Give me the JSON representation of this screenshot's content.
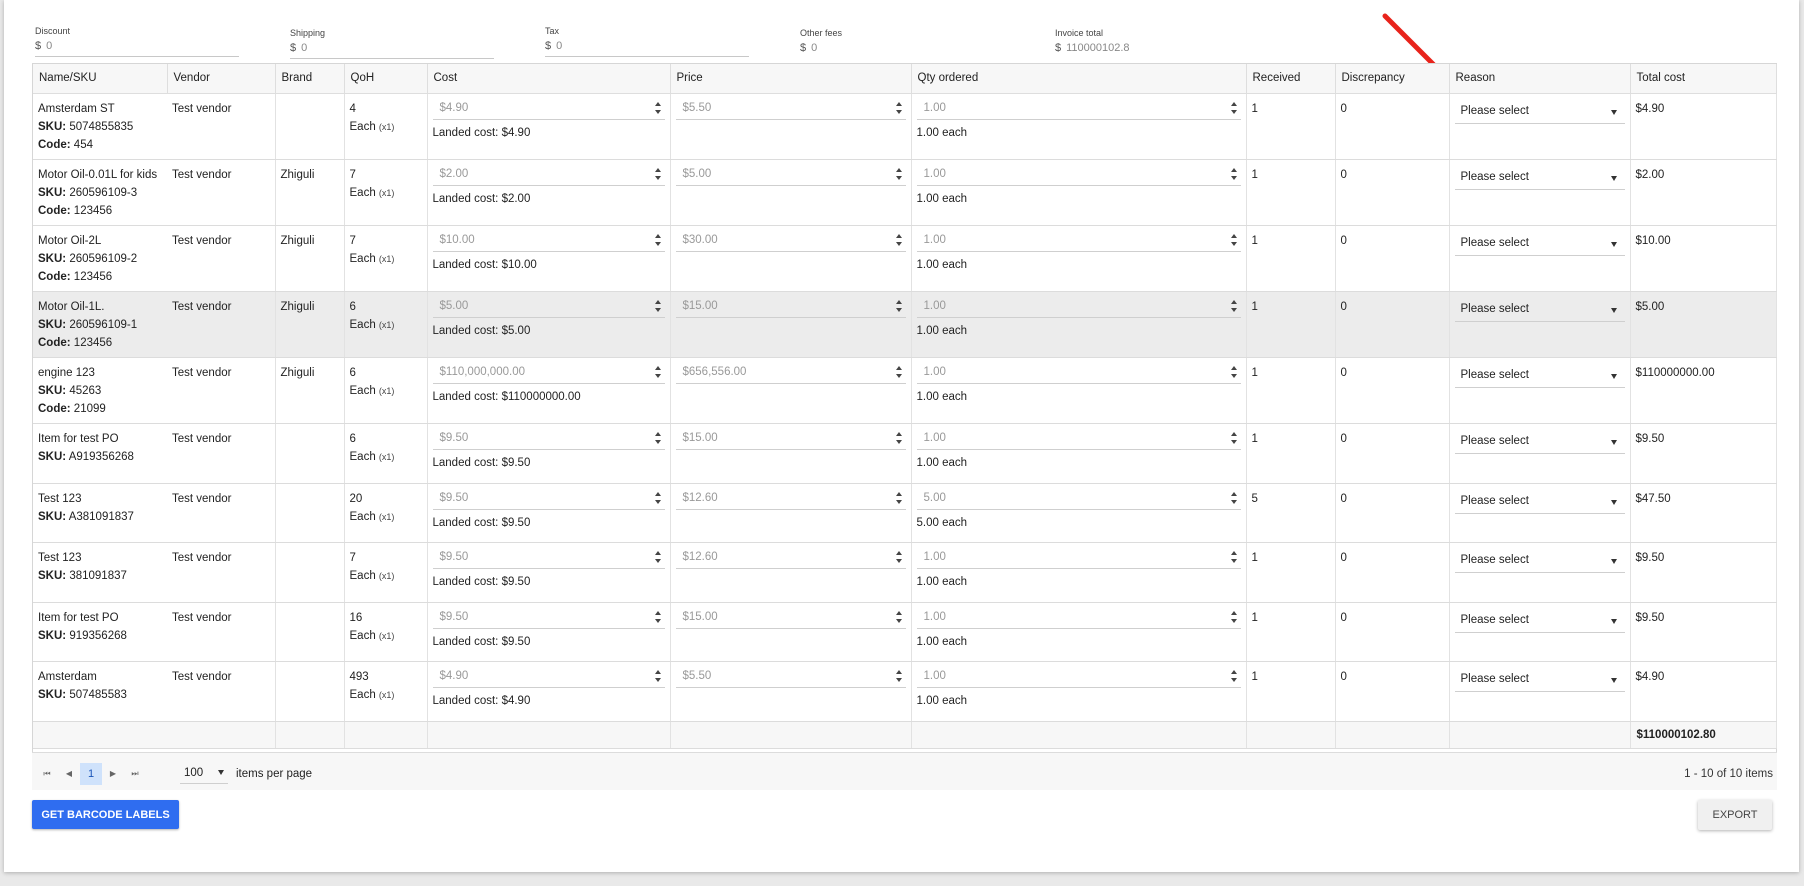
{
  "summary": {
    "discount": {
      "label": "Discount",
      "currency": "$",
      "value": "0"
    },
    "shipping": {
      "label": "Shipping",
      "currency": "$",
      "value": "0"
    },
    "tax": {
      "label": "Tax",
      "currency": "$",
      "value": "0"
    },
    "other_fees": {
      "label": "Other fees",
      "currency": "$",
      "value": "0"
    },
    "invoice_total": {
      "label": "Invoice total",
      "currency": "$",
      "value": "110000102.8"
    }
  },
  "columns": {
    "name": "Name/SKU",
    "vendor": "Vendor",
    "brand": "Brand",
    "qoh": "QoH",
    "cost": "Cost",
    "price": "Price",
    "qty": "Qty ordered",
    "received": "Received",
    "discrepancy": "Discrepancy",
    "reason": "Reason",
    "total": "Total cost"
  },
  "labels": {
    "sku": "SKU:",
    "code": "Code:",
    "landed": "Landed cost:",
    "unit": "Each",
    "unit_mult": "(x1)",
    "reason_placeholder": "Please select"
  },
  "rows": [
    {
      "name": "Amsterdam ST",
      "sku": "5074855835",
      "code": "454",
      "vendor": "Test vendor",
      "brand": "",
      "qoh": "4",
      "cost": "$4.90",
      "landed": "$4.90",
      "price": "$5.50",
      "qty": "1.00",
      "qty_each": "1.00 each",
      "received": "1",
      "discrepancy": "0",
      "total": "$4.90"
    },
    {
      "name": "Motor Oil-0.01L for kids",
      "sku": "260596109-3",
      "code": "123456",
      "vendor": "Test vendor",
      "brand": "Zhiguli",
      "qoh": "7",
      "cost": "$2.00",
      "landed": "$2.00",
      "price": "$5.00",
      "qty": "1.00",
      "qty_each": "1.00 each",
      "received": "1",
      "discrepancy": "0",
      "total": "$2.00"
    },
    {
      "name": "Motor Oil-2L",
      "sku": "260596109-2",
      "code": "123456",
      "vendor": "Test vendor",
      "brand": "Zhiguli",
      "qoh": "7",
      "cost": "$10.00",
      "landed": "$10.00",
      "price": "$30.00",
      "qty": "1.00",
      "qty_each": "1.00 each",
      "received": "1",
      "discrepancy": "0",
      "total": "$10.00"
    },
    {
      "name": "Motor Oil-1L.",
      "sku": "260596109-1",
      "code": "123456",
      "vendor": "Test vendor",
      "brand": "Zhiguli",
      "qoh": "6",
      "cost": "$5.00",
      "landed": "$5.00",
      "price": "$15.00",
      "qty": "1.00",
      "qty_each": "1.00 each",
      "received": "1",
      "discrepancy": "0",
      "total": "$5.00"
    },
    {
      "name": "engine 123",
      "sku": "45263",
      "code": "21099",
      "vendor": "Test vendor",
      "brand": "Zhiguli",
      "qoh": "6",
      "cost": "$110,000,000.00",
      "landed": "$110000000.00",
      "price": "$656,556.00",
      "qty": "1.00",
      "qty_each": "1.00 each",
      "received": "1",
      "discrepancy": "0",
      "total": "$110000000.00"
    },
    {
      "name": "Item for test PO",
      "sku": "A919356268",
      "code": "",
      "vendor": "Test vendor",
      "brand": "",
      "qoh": "6",
      "cost": "$9.50",
      "landed": "$9.50",
      "price": "$15.00",
      "qty": "1.00",
      "qty_each": "1.00 each",
      "received": "1",
      "discrepancy": "0",
      "total": "$9.50"
    },
    {
      "name": "Test 123",
      "sku": "A381091837",
      "code": "",
      "vendor": "Test vendor",
      "brand": "",
      "qoh": "20",
      "cost": "$9.50",
      "landed": "$9.50",
      "price": "$12.60",
      "qty": "5.00",
      "qty_each": "5.00 each",
      "received": "5",
      "discrepancy": "0",
      "total": "$47.50"
    },
    {
      "name": "Test 123",
      "sku": "381091837",
      "code": "",
      "vendor": "Test vendor",
      "brand": "",
      "qoh": "7",
      "cost": "$9.50",
      "landed": "$9.50",
      "price": "$12.60",
      "qty": "1.00",
      "qty_each": "1.00 each",
      "received": "1",
      "discrepancy": "0",
      "total": "$9.50"
    },
    {
      "name": "Item for test PO",
      "sku": "919356268",
      "code": "",
      "vendor": "Test vendor",
      "brand": "",
      "qoh": "16",
      "cost": "$9.50",
      "landed": "$9.50",
      "price": "$15.00",
      "qty": "1.00",
      "qty_each": "1.00 each",
      "received": "1",
      "discrepancy": "0",
      "total": "$9.50"
    },
    {
      "name": "Amsterdam",
      "sku": "507485583",
      "code": "",
      "vendor": "Test vendor",
      "brand": "",
      "qoh": "493",
      "cost": "$4.90",
      "landed": "$4.90",
      "price": "$5.50",
      "qty": "1.00",
      "qty_each": "1.00 each",
      "received": "1",
      "discrepancy": "0",
      "total": "$4.90"
    }
  ],
  "footer": {
    "grand_total": "$110000102.80"
  },
  "pager": {
    "current_page": "1",
    "page_size": "100",
    "per_page_label": "items per page",
    "info": "1 - 10 of 10 items"
  },
  "buttons": {
    "barcode": "GET BARCODE LABELS",
    "export": "EXPORT"
  },
  "colors": {
    "accent": "#2f6df0",
    "annotation": "#e8231b",
    "selected_row": "#ececec"
  }
}
